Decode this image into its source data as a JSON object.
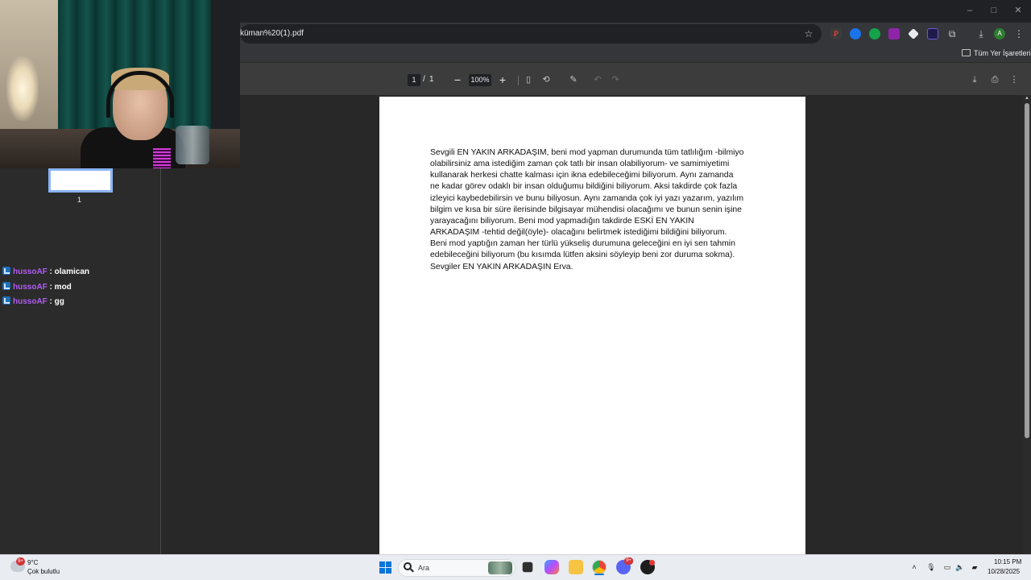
{
  "browser": {
    "url_visible": "küman%20(1).pdf",
    "bookmarks_label": "Tüm Yer İşaretleri",
    "account_initial": "A"
  },
  "pdf_toolbar": {
    "current_page": "1",
    "page_separator": "/",
    "total_pages": "1",
    "zoom_minus": "−",
    "zoom_level": "100%",
    "zoom_plus": "+"
  },
  "thumbnail": {
    "page_number": "1"
  },
  "document": {
    "lines": [
      "Sevgili EN YAKIN ARKADAŞIM, beni mod yapman durumunda tüm tatlılığım -bilmiyo",
      "olabilirsiniz ama istediğim zaman çok tatlı bir insan olabiliyorum- ve samimiyetimi",
      "kullanarak herkesi chatte kalması için ikna edebileceğimi biliyorum. Aynı zamanda",
      "ne kadar görev odaklı bir insan olduğumu bildiğini biliyorum. Aksi takdirde çok fazla",
      "izleyici kaybedebilirsin ve bunu biliyosun. Aynı zamanda çok iyi yazı yazarım, yazılım",
      "bilgim ve kısa bir süre ilerisinde bilgisayar mühendisi olacağımı ve bunun senin işine",
      "yarayacağını biliyorum. Beni mod yapmadığın takdirde ESKİ EN YAKIN",
      "ARKADAŞIM -tehtid değil(öyle)- olacağını belirtmek istediğimi bildiğini biliyorum.",
      "Beni mod yaptığın zaman her türlü yükseliş durumuna geleceğini en iyi sen tahmin",
      "edebileceğini biliyorum (bu kısımda lütfen aksini söyleyip beni zor duruma sokma).",
      "Sevgiler EN YAKIN ARKADAŞIN Erva."
    ]
  },
  "chat": {
    "messages": [
      {
        "user": "hussoAF",
        "separator": " : ",
        "text": "olamican"
      },
      {
        "user": "hussoAF",
        "separator": " : ",
        "text": "mod"
      },
      {
        "user": "hussoAF",
        "separator": " : ",
        "text": "gg"
      }
    ]
  },
  "taskbar": {
    "weather_badge": "9+",
    "weather_temp": "9°C",
    "weather_desc": "Çok bulutlu",
    "search_placeholder": "Ara",
    "discord_badge": "9+",
    "time": "10:15 PM",
    "date": "10/28/2025"
  },
  "colors": {
    "chat_username": "#b05cf2",
    "thumbnail_highlight": "#8ab4f8",
    "windows_accent": "#0a74d8"
  }
}
